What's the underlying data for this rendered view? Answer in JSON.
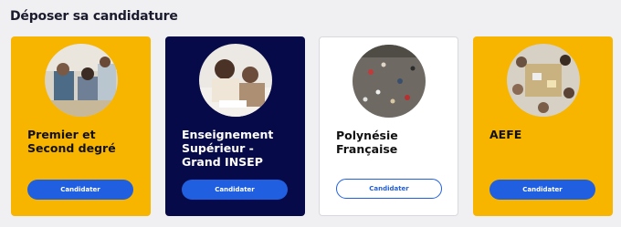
{
  "section": {
    "title": "Déposer sa candidature"
  },
  "cards": [
    {
      "title_lines": [
        "Premier et",
        "Second degré"
      ],
      "button": "Candidater"
    },
    {
      "title_lines": [
        "Enseignement",
        "Supérieur -",
        "Grand INSEP"
      ],
      "button": "Candidater"
    },
    {
      "title_lines": [
        "Polynésie",
        "Française"
      ],
      "button": "Candidater"
    },
    {
      "title_lines": [
        "AEFE"
      ],
      "button": "Candidater"
    }
  ],
  "colors": {
    "yellow": "#f7b500",
    "navy": "#070a48",
    "blue": "#1f5fe0"
  }
}
